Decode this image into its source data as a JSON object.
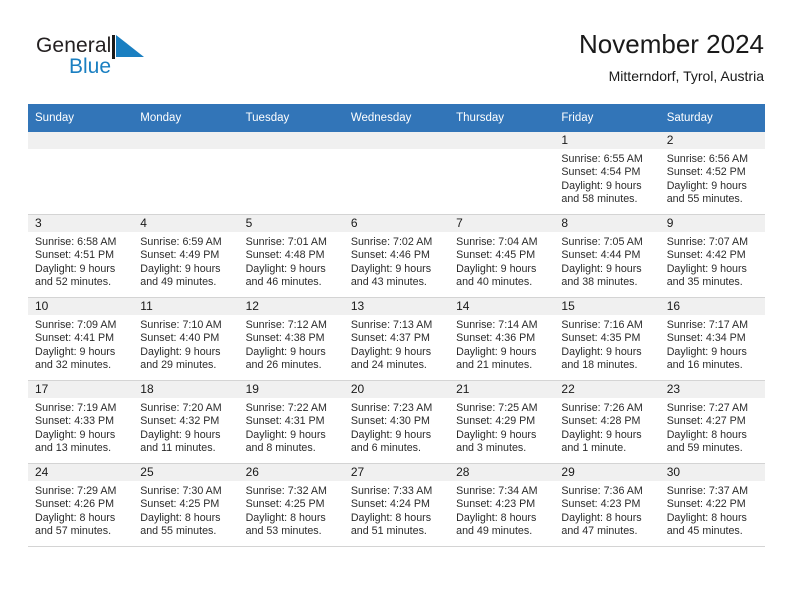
{
  "brand": {
    "name_top": "General",
    "name_bottom": "Blue",
    "mark_icon": "triangle-flag-icon",
    "accent_color": "#1a7fc1"
  },
  "header": {
    "title": "November 2024",
    "subtitle": "Mitterndorf, Tyrol, Austria"
  },
  "calendar": {
    "header_color": "#3275b8",
    "daynum_band_color": "#f0f0f0",
    "weekday_headers": [
      "Sunday",
      "Monday",
      "Tuesday",
      "Wednesday",
      "Thursday",
      "Friday",
      "Saturday"
    ],
    "weeks": [
      [
        {
          "day": "",
          "blank": true
        },
        {
          "day": "",
          "blank": true
        },
        {
          "day": "",
          "blank": true
        },
        {
          "day": "",
          "blank": true
        },
        {
          "day": "",
          "blank": true
        },
        {
          "day": "1",
          "sunrise": "Sunrise: 6:55 AM",
          "sunset": "Sunset: 4:54 PM",
          "daylight_line1": "Daylight: 9 hours",
          "daylight_line2": "and 58 minutes."
        },
        {
          "day": "2",
          "sunrise": "Sunrise: 6:56 AM",
          "sunset": "Sunset: 4:52 PM",
          "daylight_line1": "Daylight: 9 hours",
          "daylight_line2": "and 55 minutes."
        }
      ],
      [
        {
          "day": "3",
          "sunrise": "Sunrise: 6:58 AM",
          "sunset": "Sunset: 4:51 PM",
          "daylight_line1": "Daylight: 9 hours",
          "daylight_line2": "and 52 minutes."
        },
        {
          "day": "4",
          "sunrise": "Sunrise: 6:59 AM",
          "sunset": "Sunset: 4:49 PM",
          "daylight_line1": "Daylight: 9 hours",
          "daylight_line2": "and 49 minutes."
        },
        {
          "day": "5",
          "sunrise": "Sunrise: 7:01 AM",
          "sunset": "Sunset: 4:48 PM",
          "daylight_line1": "Daylight: 9 hours",
          "daylight_line2": "and 46 minutes."
        },
        {
          "day": "6",
          "sunrise": "Sunrise: 7:02 AM",
          "sunset": "Sunset: 4:46 PM",
          "daylight_line1": "Daylight: 9 hours",
          "daylight_line2": "and 43 minutes."
        },
        {
          "day": "7",
          "sunrise": "Sunrise: 7:04 AM",
          "sunset": "Sunset: 4:45 PM",
          "daylight_line1": "Daylight: 9 hours",
          "daylight_line2": "and 40 minutes."
        },
        {
          "day": "8",
          "sunrise": "Sunrise: 7:05 AM",
          "sunset": "Sunset: 4:44 PM",
          "daylight_line1": "Daylight: 9 hours",
          "daylight_line2": "and 38 minutes."
        },
        {
          "day": "9",
          "sunrise": "Sunrise: 7:07 AM",
          "sunset": "Sunset: 4:42 PM",
          "daylight_line1": "Daylight: 9 hours",
          "daylight_line2": "and 35 minutes."
        }
      ],
      [
        {
          "day": "10",
          "sunrise": "Sunrise: 7:09 AM",
          "sunset": "Sunset: 4:41 PM",
          "daylight_line1": "Daylight: 9 hours",
          "daylight_line2": "and 32 minutes."
        },
        {
          "day": "11",
          "sunrise": "Sunrise: 7:10 AM",
          "sunset": "Sunset: 4:40 PM",
          "daylight_line1": "Daylight: 9 hours",
          "daylight_line2": "and 29 minutes."
        },
        {
          "day": "12",
          "sunrise": "Sunrise: 7:12 AM",
          "sunset": "Sunset: 4:38 PM",
          "daylight_line1": "Daylight: 9 hours",
          "daylight_line2": "and 26 minutes."
        },
        {
          "day": "13",
          "sunrise": "Sunrise: 7:13 AM",
          "sunset": "Sunset: 4:37 PM",
          "daylight_line1": "Daylight: 9 hours",
          "daylight_line2": "and 24 minutes."
        },
        {
          "day": "14",
          "sunrise": "Sunrise: 7:14 AM",
          "sunset": "Sunset: 4:36 PM",
          "daylight_line1": "Daylight: 9 hours",
          "daylight_line2": "and 21 minutes."
        },
        {
          "day": "15",
          "sunrise": "Sunrise: 7:16 AM",
          "sunset": "Sunset: 4:35 PM",
          "daylight_line1": "Daylight: 9 hours",
          "daylight_line2": "and 18 minutes."
        },
        {
          "day": "16",
          "sunrise": "Sunrise: 7:17 AM",
          "sunset": "Sunset: 4:34 PM",
          "daylight_line1": "Daylight: 9 hours",
          "daylight_line2": "and 16 minutes."
        }
      ],
      [
        {
          "day": "17",
          "sunrise": "Sunrise: 7:19 AM",
          "sunset": "Sunset: 4:33 PM",
          "daylight_line1": "Daylight: 9 hours",
          "daylight_line2": "and 13 minutes."
        },
        {
          "day": "18",
          "sunrise": "Sunrise: 7:20 AM",
          "sunset": "Sunset: 4:32 PM",
          "daylight_line1": "Daylight: 9 hours",
          "daylight_line2": "and 11 minutes."
        },
        {
          "day": "19",
          "sunrise": "Sunrise: 7:22 AM",
          "sunset": "Sunset: 4:31 PM",
          "daylight_line1": "Daylight: 9 hours",
          "daylight_line2": "and 8 minutes."
        },
        {
          "day": "20",
          "sunrise": "Sunrise: 7:23 AM",
          "sunset": "Sunset: 4:30 PM",
          "daylight_line1": "Daylight: 9 hours",
          "daylight_line2": "and 6 minutes."
        },
        {
          "day": "21",
          "sunrise": "Sunrise: 7:25 AM",
          "sunset": "Sunset: 4:29 PM",
          "daylight_line1": "Daylight: 9 hours",
          "daylight_line2": "and 3 minutes."
        },
        {
          "day": "22",
          "sunrise": "Sunrise: 7:26 AM",
          "sunset": "Sunset: 4:28 PM",
          "daylight_line1": "Daylight: 9 hours",
          "daylight_line2": "and 1 minute."
        },
        {
          "day": "23",
          "sunrise": "Sunrise: 7:27 AM",
          "sunset": "Sunset: 4:27 PM",
          "daylight_line1": "Daylight: 8 hours",
          "daylight_line2": "and 59 minutes."
        }
      ],
      [
        {
          "day": "24",
          "sunrise": "Sunrise: 7:29 AM",
          "sunset": "Sunset: 4:26 PM",
          "daylight_line1": "Daylight: 8 hours",
          "daylight_line2": "and 57 minutes."
        },
        {
          "day": "25",
          "sunrise": "Sunrise: 7:30 AM",
          "sunset": "Sunset: 4:25 PM",
          "daylight_line1": "Daylight: 8 hours",
          "daylight_line2": "and 55 minutes."
        },
        {
          "day": "26",
          "sunrise": "Sunrise: 7:32 AM",
          "sunset": "Sunset: 4:25 PM",
          "daylight_line1": "Daylight: 8 hours",
          "daylight_line2": "and 53 minutes."
        },
        {
          "day": "27",
          "sunrise": "Sunrise: 7:33 AM",
          "sunset": "Sunset: 4:24 PM",
          "daylight_line1": "Daylight: 8 hours",
          "daylight_line2": "and 51 minutes."
        },
        {
          "day": "28",
          "sunrise": "Sunrise: 7:34 AM",
          "sunset": "Sunset: 4:23 PM",
          "daylight_line1": "Daylight: 8 hours",
          "daylight_line2": "and 49 minutes."
        },
        {
          "day": "29",
          "sunrise": "Sunrise: 7:36 AM",
          "sunset": "Sunset: 4:23 PM",
          "daylight_line1": "Daylight: 8 hours",
          "daylight_line2": "and 47 minutes."
        },
        {
          "day": "30",
          "sunrise": "Sunrise: 7:37 AM",
          "sunset": "Sunset: 4:22 PM",
          "daylight_line1": "Daylight: 8 hours",
          "daylight_line2": "and 45 minutes."
        }
      ]
    ]
  }
}
